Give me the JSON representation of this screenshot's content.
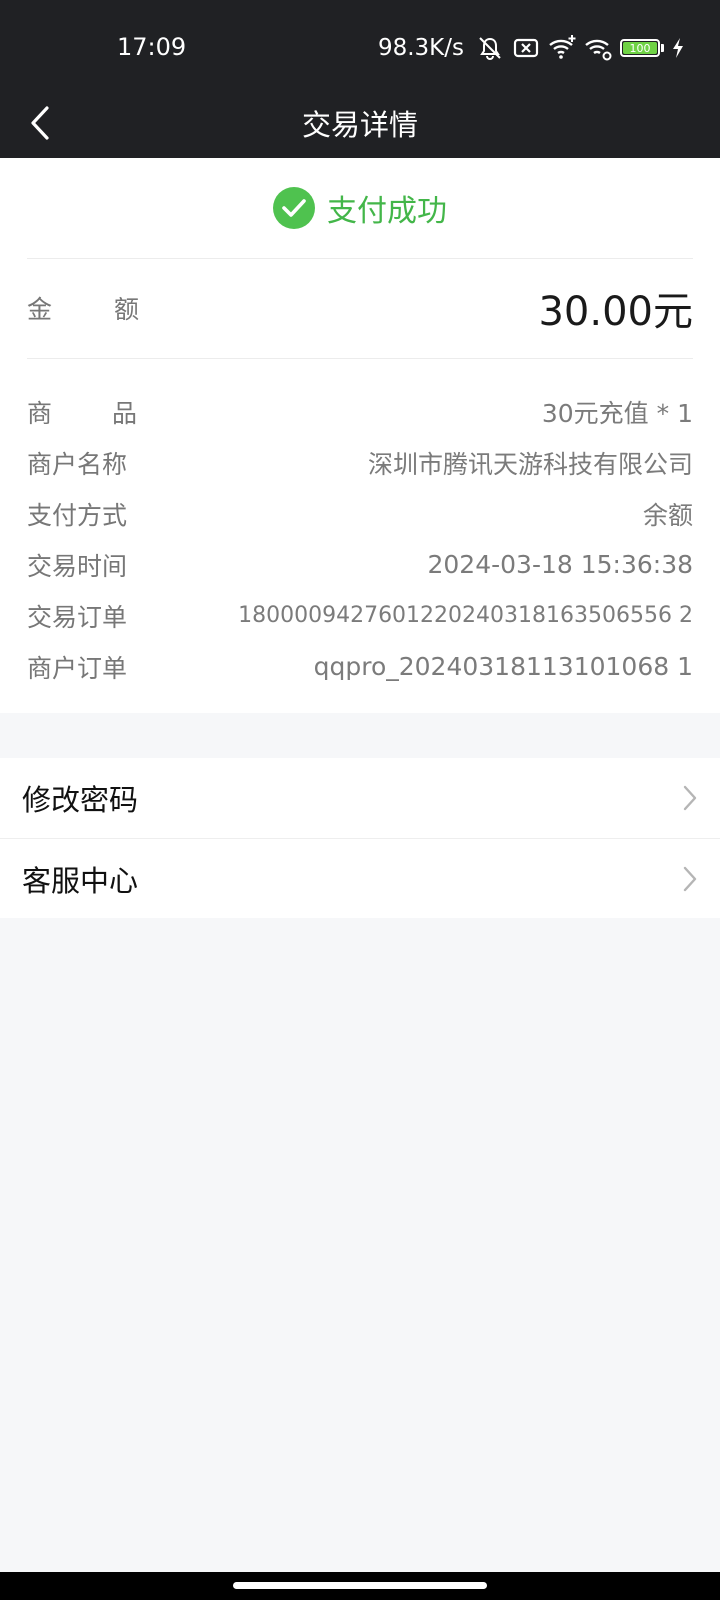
{
  "status_bar": {
    "time": "17:09",
    "network_speed": "98.3K/s",
    "battery_level": "100",
    "icons": [
      "mute-icon",
      "sim-x-icon",
      "wifi-plus-icon",
      "wifi-6-icon",
      "battery-icon",
      "charging-icon"
    ]
  },
  "nav": {
    "title": "交易详情",
    "back_icon": "back-chevron-icon"
  },
  "transaction": {
    "status_icon": "check-circle-icon",
    "status_text": "支付成功",
    "status_color": "#43b649",
    "amount_label_1": "金",
    "amount_label_2": "额",
    "amount_value": "30.00元",
    "details": {
      "product_label_1": "商",
      "product_label_2": "品",
      "product_value": "30元充值 * 1",
      "merchant_name_label": "商户名称",
      "merchant_name_value": "深圳市腾讯天游科技有限公司",
      "payment_method_label": "支付方式",
      "payment_method_value": "余额",
      "time_label": "交易时间",
      "time_value": "2024-03-18 15:36:38",
      "order_label": "交易订单",
      "order_value": "1800009427601220240318163506556 2",
      "merchant_order_label": "商户订单",
      "merchant_order_value": "qqpro_20240318113101068 1"
    }
  },
  "menu": {
    "items": [
      {
        "label": "修改密码",
        "icon": "chevron-right-icon"
      },
      {
        "label": "客服中心",
        "icon": "chevron-right-icon"
      }
    ]
  }
}
